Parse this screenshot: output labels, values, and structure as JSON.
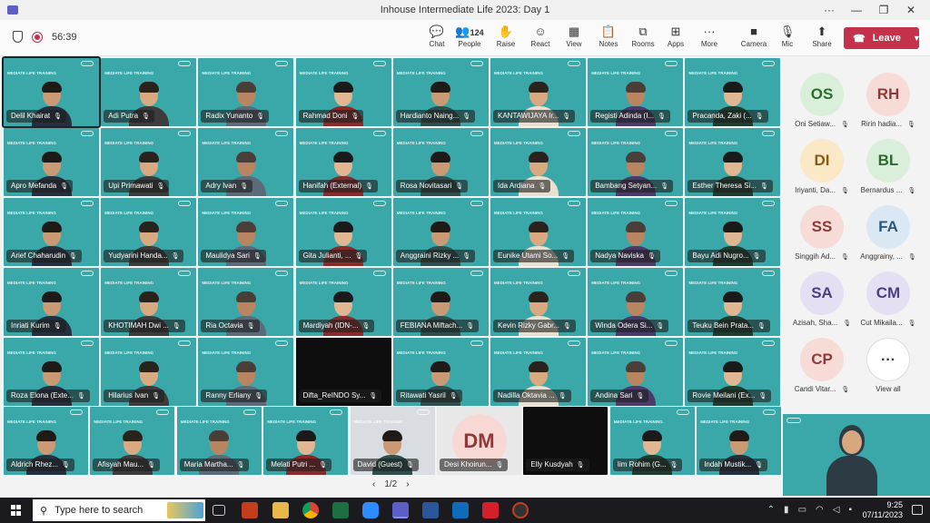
{
  "window": {
    "title": "Inhouse Intermediate Life 2023: Day 1",
    "controls": [
      "···",
      "—",
      "❐",
      "✕"
    ]
  },
  "meeting": {
    "timer": "56:39"
  },
  "toolbar": {
    "buttons": [
      {
        "label": "Chat",
        "icon": "chat-icon",
        "glyph": "💬"
      },
      {
        "label": "People",
        "icon": "people-icon",
        "glyph": "👥",
        "count": "124"
      },
      {
        "label": "Raise",
        "icon": "raise-hand-icon",
        "glyph": "✋"
      },
      {
        "label": "React",
        "icon": "react-icon",
        "glyph": "☺"
      },
      {
        "label": "View",
        "icon": "view-icon",
        "glyph": "▦"
      },
      {
        "label": "Notes",
        "icon": "notes-icon",
        "glyph": "📋"
      },
      {
        "label": "Rooms",
        "icon": "rooms-icon",
        "glyph": "⧉"
      },
      {
        "label": "Apps",
        "icon": "apps-icon",
        "glyph": "⊞"
      },
      {
        "label": "More",
        "icon": "more-icon",
        "glyph": "···"
      },
      {
        "label": "Camera",
        "icon": "camera-icon",
        "glyph": "■"
      },
      {
        "label": "Mic",
        "icon": "mic-muted-icon",
        "glyph": "🎙"
      },
      {
        "label": "Share",
        "icon": "share-icon",
        "glyph": "⬆"
      }
    ],
    "leave": "Leave"
  },
  "tile_text": "MEDIATE LIFE TRAINING",
  "participants": [
    "Delil Khairat",
    "Adi Putra",
    "Radix Yunanto",
    "Rahmad Doni",
    "Hardianto Naing...",
    "KANTAWIJAYA Ir...",
    "Registi Adinda (I...",
    "Pracanda, Zaki (...",
    "Apro Mefanda",
    "Upi Primawati",
    "Adry Ivan",
    "Hanifah (External)",
    "Rosa Novitasari",
    "Ida Ardiana",
    "Bambang Setyan...",
    "Esther Theresa Si...",
    "Arief Chaharudin",
    "Yudyarini Handa...",
    "Maulidya Sari",
    "Gita Julianti, ...",
    "Anggraini Rizky ...",
    "Eunike Utami So...",
    "Nadya Naviska",
    "Bayu Adi Nugro...",
    "Inriati Kurim",
    "KHOTIMAH Dwi ...",
    "Ria Octavia",
    "Mardiyah (IDN-...",
    "FEBIANA Miftach...",
    "Kevin Rizky Gabr...",
    "Winda Odera Si...",
    "Teuku Bein Prata...",
    "Roza Elona (Exte...",
    "Hilarius Ivan",
    "Ranny Erliany",
    "Difta_ReINDO Sy...",
    "Ritawati Yasril",
    "Nadilla Oktavia ...",
    "Andina Sari",
    "Rovie Meilani (Ex...",
    "Aldrich Rhez...",
    "Afisyah Mau...",
    "Maria Martha...",
    "Melati Putri ...",
    "David (Guest)",
    "Desi Khoirun...",
    "Elly Kusdyah",
    "Iim Rohim (G...",
    "Indah Mustik..."
  ],
  "avatar_initials": {
    "Desi Khoirun...": "DM"
  },
  "pager": {
    "prev": "‹",
    "page": "1/2",
    "next": "›"
  },
  "roster": [
    {
      "initials": "OS",
      "name": "Oni Setiaw...",
      "bg": "#d9efd9",
      "fg": "#2e6b2e"
    },
    {
      "initials": "RH",
      "name": "Ririn hadia...",
      "bg": "#f7dbd6",
      "fg": "#8e3a3a"
    },
    {
      "initials": "DI",
      "name": "Iriyanti, Da...",
      "bg": "#fbe8c6",
      "fg": "#8a5a12"
    },
    {
      "initials": "BL",
      "name": "Bernardus ...",
      "bg": "#d9efd9",
      "fg": "#2e6b2e"
    },
    {
      "initials": "SS",
      "name": "Singgih Ad...",
      "bg": "#f7dbd6",
      "fg": "#8e3a3a"
    },
    {
      "initials": "FA",
      "name": "Anggrainy, ...",
      "bg": "#d9e8f2",
      "fg": "#2c5a7a"
    },
    {
      "initials": "SA",
      "name": "Azisah, Sha...",
      "bg": "#e4dff2",
      "fg": "#4d3f82"
    },
    {
      "initials": "CM",
      "name": "Cut Mikaila...",
      "bg": "#e4dff2",
      "fg": "#4d3f82"
    },
    {
      "initials": "CP",
      "name": "Candi Vitar...",
      "bg": "#f7dbd6",
      "fg": "#8e3a3a"
    },
    {
      "initials": "···",
      "name": "View all",
      "bg": "#ffffff",
      "fg": "#333333"
    }
  ],
  "taskbar": {
    "search_placeholder": "Type here to search",
    "time": "9:25",
    "date": "07/11/2023"
  },
  "colors": {
    "tile_bg": "#3aa7a8",
    "leave": "#c4314b",
    "taskbar": "#1b1b1f"
  }
}
